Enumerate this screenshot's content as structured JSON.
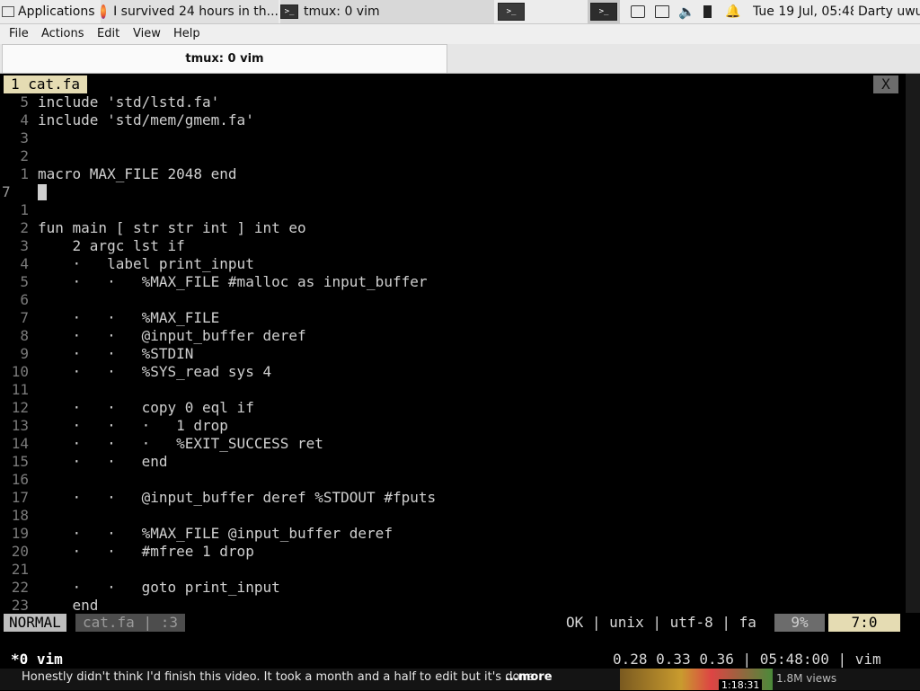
{
  "taskbar": {
    "applications": "Applications",
    "browser_title": "I survived 24 hours in th...",
    "terminal_title": "tmux: 0 vim",
    "clock": "Tue 19 Jul, 05:48",
    "user": "Darty uwu",
    "term_icon_glyph": ">_"
  },
  "menu": {
    "file": "File",
    "actions": "Actions",
    "edit": "Edit",
    "view": "View",
    "help": "Help"
  },
  "tab": {
    "title": "tmux: 0 vim"
  },
  "vim": {
    "buffer_tab": "1 cat.fa",
    "close_label": "X",
    "lines": [
      {
        "n": "5",
        "text": "include 'std/lstd.fa'"
      },
      {
        "n": "4",
        "text": "include 'std/mem/gmem.fa'"
      },
      {
        "n": "3",
        "text": ""
      },
      {
        "n": "2",
        "text": ""
      },
      {
        "n": "1",
        "text": "macro MAX_FILE 2048 end"
      },
      {
        "n": "7",
        "text": "",
        "current": true
      },
      {
        "n": "1",
        "text": ""
      },
      {
        "n": "2",
        "text": "fun main [ str str int ] int eo"
      },
      {
        "n": "3",
        "text": "    2 argc lst if"
      },
      {
        "n": "4",
        "text": "    ·   label print_input"
      },
      {
        "n": "5",
        "text": "    ·   ·   %MAX_FILE #malloc as input_buffer"
      },
      {
        "n": "6",
        "text": ""
      },
      {
        "n": "7",
        "text": "    ·   ·   %MAX_FILE"
      },
      {
        "n": "8",
        "text": "    ·   ·   @input_buffer deref"
      },
      {
        "n": "9",
        "text": "    ·   ·   %STDIN"
      },
      {
        "n": "10",
        "text": "    ·   ·   %SYS_read sys 4"
      },
      {
        "n": "11",
        "text": ""
      },
      {
        "n": "12",
        "text": "    ·   ·   copy 0 eql if"
      },
      {
        "n": "13",
        "text": "    ·   ·   ·   1 drop"
      },
      {
        "n": "14",
        "text": "    ·   ·   ·   %EXIT_SUCCESS ret"
      },
      {
        "n": "15",
        "text": "    ·   ·   end"
      },
      {
        "n": "16",
        "text": ""
      },
      {
        "n": "17",
        "text": "    ·   ·   @input_buffer deref %STDOUT #fputs"
      },
      {
        "n": "18",
        "text": ""
      },
      {
        "n": "19",
        "text": "    ·   ·   %MAX_FILE @input_buffer deref"
      },
      {
        "n": "20",
        "text": "    ·   ·   #mfree 1 drop"
      },
      {
        "n": "21",
        "text": ""
      },
      {
        "n": "22",
        "text": "    ·   ·   goto print_input"
      },
      {
        "n": "23",
        "text": "    end"
      }
    ],
    "status": {
      "mode": "NORMAL",
      "file": "cat.fa",
      "file_col": ":3",
      "info": "OK | unix | utf-8 | fa",
      "percent": "9%",
      "position": "7:0"
    }
  },
  "tmux": {
    "window": "*0 vim",
    "right": "0.28 0.33 0.36 | 05:48:00 | vim"
  },
  "video": {
    "description": "Honestly didn't think I'd finish this video. It took a month and a half to edit but it's done",
    "more": "...more",
    "duration": "1:18:31",
    "views": "1.8M views"
  }
}
